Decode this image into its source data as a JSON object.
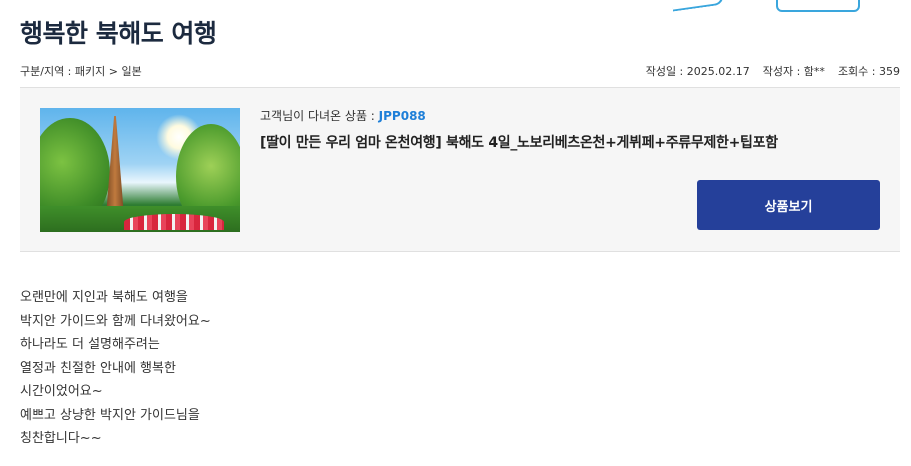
{
  "review": {
    "title": "행복한 북해도 여행",
    "category": "구분/지역 : 패키지 > 일본",
    "date": "작성일 : 2025.02.17",
    "author": "작성자 : 함**",
    "views": "조회수 : 359"
  },
  "product": {
    "label": "고객님이 다녀온 상품 : ",
    "code": "JPP088",
    "title": "[딸이 만든 우리 엄마 온천여행] 북해도 4일_노보리베츠온천+게뷔페+주류무제한+팁포함",
    "button_label": "상품보기"
  },
  "content": {
    "lines": [
      "오랜만에 지인과 북해도 여행을",
      "박지안 가이드와 함께 다녀왔어요~",
      "하나라도 더 설명해주려는",
      "열정과 친절한 안내에 행복한",
      "시간이었어요~",
      "예쁘고 상냥한 박지안 가이드님을",
      "칭찬합니다~~"
    ]
  },
  "colors": {
    "title": "#1c2a3f",
    "code": "#1e7fd8",
    "button_bg": "#25409a",
    "box_bg": "#f6f6f6"
  }
}
